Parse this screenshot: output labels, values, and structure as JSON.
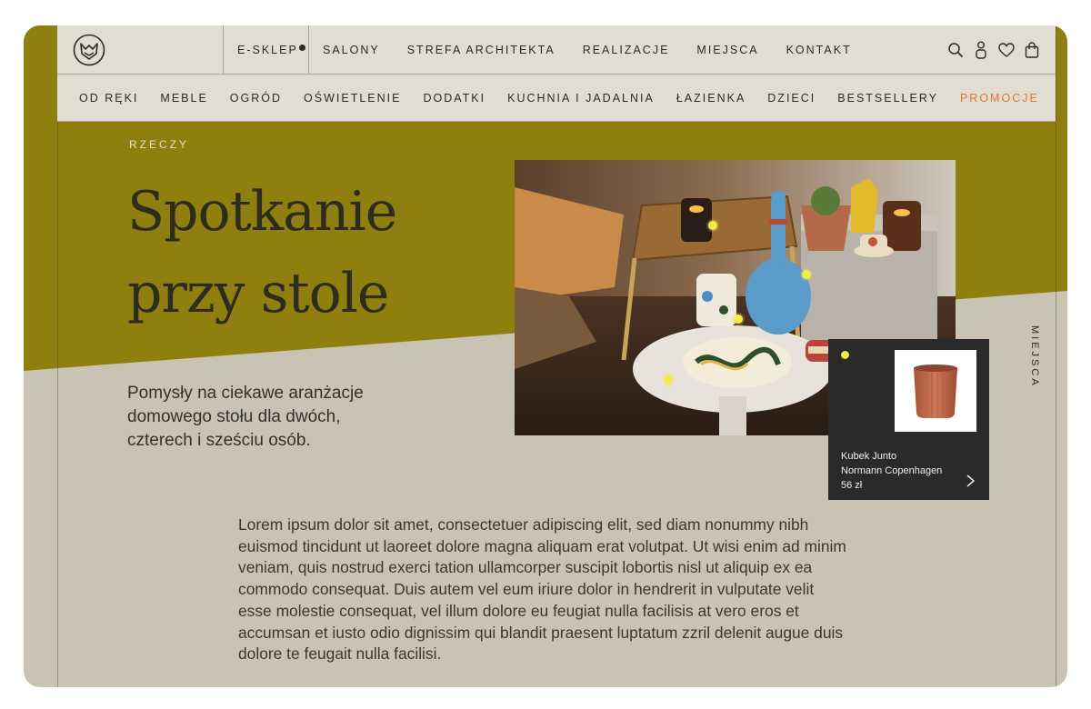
{
  "colors": {
    "olive": "#8f7f0e",
    "beige": "#c8c3b2",
    "nav_bg": "#e2ddd3",
    "promo": "#e0772a",
    "hotspot": "#f2ec4a",
    "card_bg": "#2a2a2a"
  },
  "header": {
    "logo_icon": "fox-monogram-logo",
    "shop_link": "E-SKLEP",
    "nav": [
      "SALONY",
      "STREFA ARCHITEKTA",
      "REALIZACJE",
      "MIEJSCA",
      "KONTAKT"
    ],
    "icons": [
      "search-icon",
      "user-icon",
      "heart-icon",
      "bag-icon"
    ]
  },
  "categories": [
    "OD RĘKI",
    "MEBLE",
    "OGRÓD",
    "OŚWIETLENIE",
    "DODATKI",
    "KUCHNIA I JADALNIA",
    "ŁAZIENKA",
    "DZIECI",
    "BESTSELLERY",
    "PROMOCJE"
  ],
  "hero": {
    "eyebrow": "RZECZY",
    "title_line1": "Spotkanie",
    "title_line2": "przy stole",
    "lead": "Pomysły na ciekawe aranżacje domowego stołu dla dwóch, czterech i sześciu osób."
  },
  "product_card": {
    "name": "Kubek Junto",
    "brand": "Normann Copenhagen",
    "price": "56 zł"
  },
  "side_tab": "MIEJSCA",
  "article_text": "Lorem ipsum dolor sit amet, consectetuer adipiscing elit, sed diam nonummy nibh euismod tincidunt ut laoreet dolore magna aliquam erat volutpat. Ut wisi enim ad minim veniam, quis nostrud exerci tation ullamcorper suscipit lobortis nisl ut aliquip ex ea commodo consequat. Duis autem vel eum iriure dolor in hendrerit in vulputate velit esse molestie consequat, vel illum dolore eu feugiat nulla facilisis at vero eros et accumsan et iusto odio dignissim qui blandit praesent luptatum zzril delenit augue duis dolore te feugait nulla facilisi."
}
